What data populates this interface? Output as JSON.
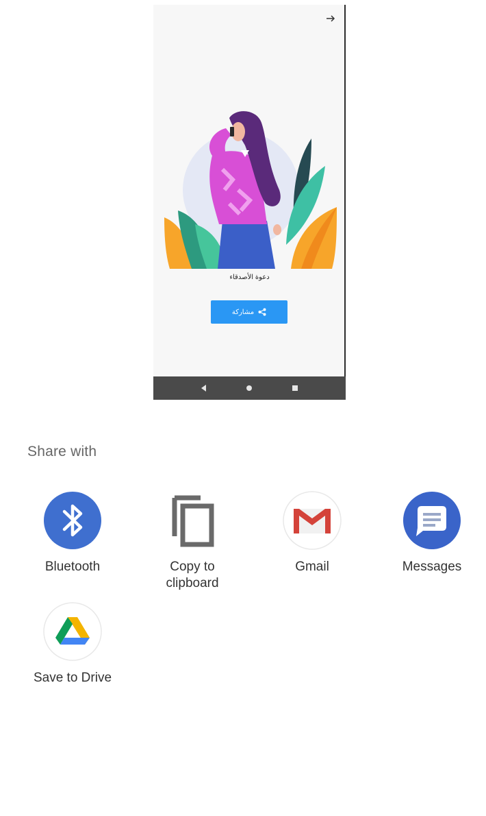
{
  "phone": {
    "invite_title": "دعوة الأصدقاء",
    "share_label": "مشاركة",
    "icons": {
      "back": "arrow-right-icon",
      "share": "share-icon",
      "nav_back": "nav-back-icon",
      "nav_home": "nav-home-icon",
      "nav_recent": "nav-recent-icon"
    },
    "colors": {
      "button": "#2a97f4",
      "navbar": "#4a4a4a",
      "background": "#f7f7f7"
    }
  },
  "share_sheet": {
    "title": "Share with",
    "apps": [
      {
        "label": "Bluetooth",
        "icon": "bluetooth-icon"
      },
      {
        "label": "Copy to\nclipboard",
        "icon": "copy-icon"
      },
      {
        "label": "Gmail",
        "icon": "gmail-icon"
      },
      {
        "label": "Messages",
        "icon": "messages-icon"
      },
      {
        "label": "Save to Drive",
        "icon": "drive-icon"
      }
    ]
  }
}
